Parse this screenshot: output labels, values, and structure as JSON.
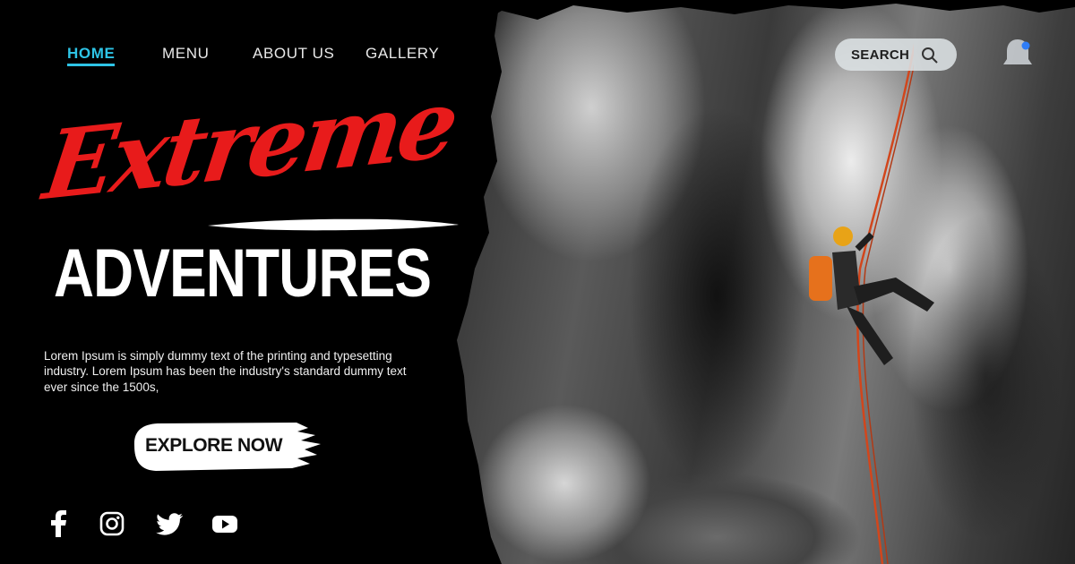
{
  "nav": {
    "items": [
      {
        "label": "HOME",
        "active": true
      },
      {
        "label": "MENU",
        "active": false
      },
      {
        "label": "ABOUT US",
        "active": false
      },
      {
        "label": "GALLERY",
        "active": false
      }
    ]
  },
  "search": {
    "label": "SEARCH",
    "icon": "search-icon"
  },
  "notification": {
    "icon": "bell-icon",
    "indicator_color": "#2f7df6"
  },
  "hero": {
    "script_title": "Extreme",
    "main_title": "ADVENTURES",
    "description": "Lorem Ipsum is simply dummy text of the printing and typesetting industry. Lorem Ipsum has been the industry's standard dummy text ever since the 1500s,",
    "cta_label": "EXPLORE NOW"
  },
  "social": [
    {
      "icon": "facebook-icon"
    },
    {
      "icon": "instagram-icon"
    },
    {
      "icon": "twitter-icon"
    },
    {
      "icon": "youtube-icon"
    }
  ],
  "colors": {
    "background": "#000000",
    "accent": "#2ec4e6",
    "script_red": "#e81b1b",
    "text": "#ffffff"
  }
}
